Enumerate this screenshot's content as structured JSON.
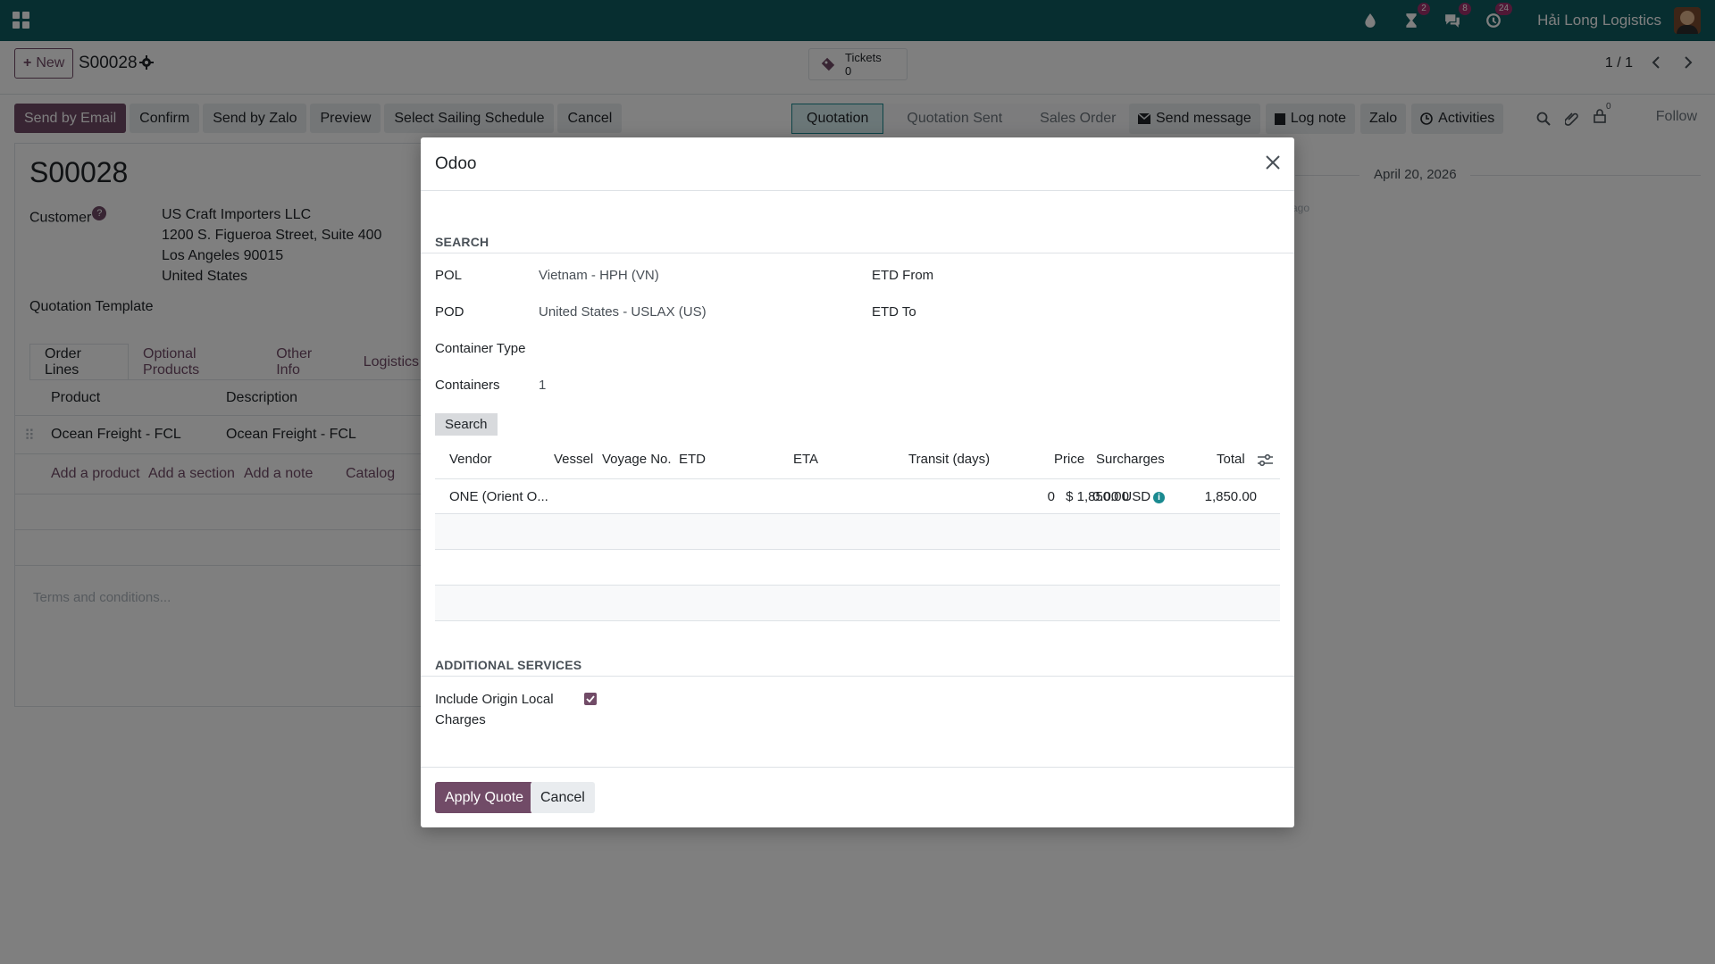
{
  "navbar": {
    "company": "Hải Long Logistics",
    "badges": {
      "activity": "2",
      "messages": "8",
      "clock": "24"
    }
  },
  "control_panel": {
    "new_label": "New",
    "record_name": "S00028",
    "tickets_label": "Tickets",
    "tickets_count": "0",
    "pager": "1 / 1"
  },
  "actions": {
    "send_by_email": "Send by Email",
    "confirm": "Confirm",
    "send_by_zalo": "Send by Zalo",
    "preview": "Preview",
    "select_sailing": "Select Sailing Schedule",
    "cancel": "Cancel"
  },
  "status_stages": [
    "Quotation",
    "Quotation Sent",
    "Sales Order"
  ],
  "chatter": {
    "send_message": "Send message",
    "log_note": "Log note",
    "zalo": "Zalo",
    "activities": "Activities",
    "followers_count": "0",
    "follow": "Follow",
    "date": "April 20, 2026",
    "ago": "ago"
  },
  "form": {
    "title": "S00028",
    "customer_label": "Customer",
    "customer_help": "?",
    "customer_name": "US Craft Importers LLC",
    "address_line1": "1200 S. Figueroa Street, Suite 400",
    "address_line2": "Los Angeles 90015",
    "address_line3": "United States",
    "quotation_template_label": "Quotation Template",
    "tabs": [
      "Order Lines",
      "Optional Products",
      "Other Info",
      "Logistics"
    ],
    "order_lines": {
      "headers": {
        "product": "Product",
        "description": "Description"
      },
      "rows": [
        {
          "product": "Ocean Freight - FCL",
          "description": "Ocean Freight - FCL"
        }
      ],
      "add_product": "Add a product",
      "add_section": "Add a section",
      "add_note": "Add a note",
      "catalog": "Catalog"
    },
    "terms_placeholder": "Terms and conditions..."
  },
  "modal": {
    "title": "Odoo",
    "search_section": "SEARCH",
    "pol_label": "POL",
    "pol_value": "Vietnam - HPH (VN)",
    "pod_label": "POD",
    "pod_value": "United States - USLAX (US)",
    "etd_from_label": "ETD From",
    "etd_to_label": "ETD To",
    "container_type_label": "Container Type",
    "containers_label": "Containers",
    "containers_value": "1",
    "search_button": "Search",
    "table": {
      "headers": {
        "vendor": "Vendor",
        "vessel": "Vessel",
        "voyage": "Voyage No.",
        "etd": "ETD",
        "eta": "ETA",
        "transit": "Transit (days)",
        "price": "Price",
        "surcharges": "Surcharges",
        "total": "Total"
      },
      "rows": [
        {
          "vendor": "ONE (Orient O...",
          "transit": "0",
          "price": "$ 1,850.00",
          "surcharges": "0.00 USD",
          "total": "1,850.00"
        }
      ]
    },
    "additional_section": "ADDITIONAL SERVICES",
    "include_origin_label_1": "Include Origin Local",
    "include_origin_label_2": "Charges",
    "include_origin_checked": true,
    "apply_button": "Apply Quote",
    "cancel_button": "Cancel"
  },
  "colors": {
    "navbar": "#0f5c60",
    "primary": "#714b67",
    "info": "#1a8a90"
  }
}
